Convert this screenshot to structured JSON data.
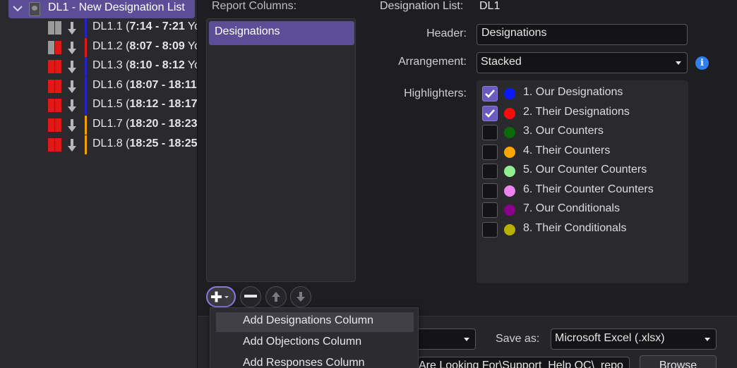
{
  "tree": {
    "header_title": "DL1 - New Designation List",
    "rows": [
      {
        "id": "DL1.1 (",
        "times": "7:14",
        "sep": " - ",
        "end": "7:21",
        "tail": " Yo",
        "pip_a": "#9a9a9a",
        "pip_b": "#9a9a9a",
        "bar": "#2323c8"
      },
      {
        "id": "DL1.2 (",
        "times": "8:07",
        "sep": " - ",
        "end": "8:09",
        "tail": " Yo",
        "pip_a": "#9a9a9a",
        "pip_b": "#e01818",
        "bar": "#e01818"
      },
      {
        "id": "DL1.3 (",
        "times": "8:10",
        "sep": " - ",
        "end": "8:12",
        "tail": " Yo",
        "pip_a": "#e01818",
        "pip_b": "#e01818",
        "bar": "#2323c8"
      },
      {
        "id": "DL1.6 (",
        "times": "18:07",
        "sep": " - ",
        "end": "18:11",
        "tail": "",
        "pip_a": "#e01818",
        "pip_b": "#e01818",
        "bar": "#2323c8"
      },
      {
        "id": "DL1.5 (",
        "times": "18:12",
        "sep": " - ",
        "end": "18:17",
        "tail": "",
        "pip_a": "#e01818",
        "pip_b": "#e01818",
        "bar": "#2323c8"
      },
      {
        "id": "DL1.7 (",
        "times": "18:20",
        "sep": " - ",
        "end": "18:23",
        "tail": "",
        "pip_a": "#e01818",
        "pip_b": "#e01818",
        "bar": "#f0a000"
      },
      {
        "id": "DL1.8 (",
        "times": "18:25",
        "sep": " - ",
        "end": "18:25",
        "tail": "",
        "pip_a": "#e01818",
        "pip_b": "#e01818",
        "bar": "#f0a000"
      }
    ]
  },
  "report_columns": {
    "label": "Report Columns:",
    "items": [
      "Designations"
    ]
  },
  "menu": {
    "items": [
      "Add Designations Column",
      "Add Objections Column",
      "Add Responses Column"
    ]
  },
  "details": {
    "dl_label": "Designation List:",
    "dl_value": "DL1",
    "header_label": "Header:",
    "header_value": "Designations",
    "arrangement_label": "Arrangement:",
    "arrangement_value": "Stacked",
    "highlighters_label": "Highlighters:",
    "highlighters": [
      {
        "label": "1. Our Designations",
        "checked": true,
        "color": "#0a1aff"
      },
      {
        "label": "2. Their Designations",
        "checked": true,
        "color": "#ff0a0a"
      },
      {
        "label": "3. Our Counters",
        "checked": false,
        "color": "#0a6a0a"
      },
      {
        "label": "4. Their Counters",
        "checked": false,
        "color": "#ffa500"
      },
      {
        "label": "5. Our Counter Counters",
        "checked": false,
        "color": "#90ee90"
      },
      {
        "label": "6. Their Counter Counters",
        "checked": false,
        "color": "#ee82ee"
      },
      {
        "label": "7. Our Conditionals",
        "checked": false,
        "color": "#8a008a"
      },
      {
        "label": "8. Their Conditionals",
        "checked": false,
        "color": "#b8b000"
      }
    ]
  },
  "export": {
    "save_as_label": "Save as:",
    "save_as_value": "Microsoft Excel (.xlsx)",
    "path_value": " Are Looking For\\Support_Help QC\\_repo",
    "browse_label": "Browse"
  }
}
